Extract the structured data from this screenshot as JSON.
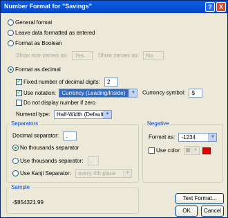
{
  "title": "Number Format for \"Savings\"",
  "title_buttons": {
    "help": "?",
    "close": "X"
  },
  "options": {
    "general": "General format",
    "leave": "Leave data formatted as entered",
    "boolean": "Format as Boolean",
    "show_non_zeroes_label": "Show non-zeroes as:",
    "show_non_zeroes_value": "Yes",
    "show_zeroes_label": "Show zeroes as:",
    "show_zeroes_value": "No",
    "decimal": "Format as decimal",
    "fixed_digits_label": "Fixed number of decimal digits:",
    "fixed_digits_value": "2",
    "use_notation_label": "Use notation:",
    "notation_value": "Currency (Leading/Inside)",
    "currency_symbol_label": "Currency symbol:",
    "currency_symbol_value": "$",
    "no_zero_label": "Do not display number if zero",
    "numeral_type_label": "Numeral type:",
    "numeral_type_value": "Half-Width (Default)"
  },
  "separators": {
    "title": "Separators",
    "decimal_label": "Decimal separator:",
    "decimal_value": ".",
    "no_thousands": "No thousands separator",
    "use_thousands": "Use thousands separator:",
    "thousands_value": ",",
    "use_kanji": "Use Kanji Separator:",
    "kanji_value": "every 4th place"
  },
  "negative": {
    "title": "Negative",
    "format_label": "Format as:",
    "format_value": "-1234",
    "use_color_label": "Use color:",
    "color": "#e00000"
  },
  "sample": {
    "title": "Sample",
    "value": "-$854321.99"
  },
  "buttons": {
    "text_format": "Text Format...",
    "ok": "OK",
    "cancel": "Cancel"
  }
}
